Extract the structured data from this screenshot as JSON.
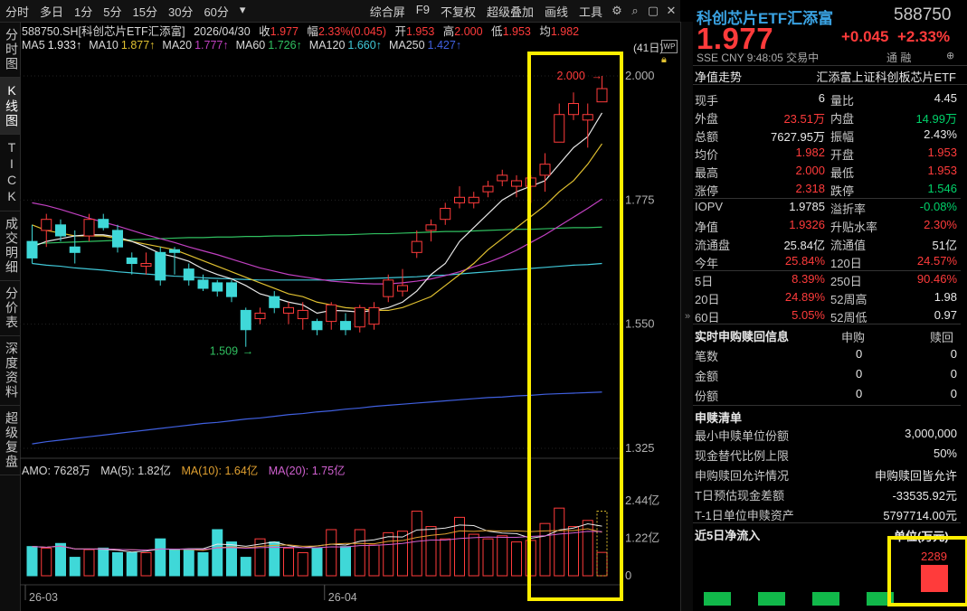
{
  "toolbar": {
    "periods": [
      "分时",
      "多日",
      "1分",
      "5分",
      "15分",
      "30分",
      "60分",
      "▾"
    ],
    "tools": [
      "综合屏",
      "F9",
      "不复权",
      "超级叠加",
      "画线",
      "工具"
    ]
  },
  "left_tabs": [
    "分时图",
    "K线图",
    "TICK",
    "成交明细",
    "分价表",
    "深度资料",
    "超级复盘"
  ],
  "header": {
    "code_line": "588750.SH[科创芯片ETF汇添富]",
    "date": "2026/04/30",
    "close_label": "收",
    "close": "1.977",
    "amp_label": "幅",
    "amp": "2.33%(0.045)",
    "open_label": "开",
    "open": "1.953",
    "high_label": "高",
    "high": "2.000",
    "low_label": "低",
    "low": "1.953",
    "avg_label": "均",
    "avg": "1.982"
  },
  "ma_legend": [
    {
      "name": "MA5",
      "value": "1.933↑",
      "color": "#e8e8e8"
    },
    {
      "name": "MA10",
      "value": "1.877↑",
      "color": "#e0c030"
    },
    {
      "name": "MA20",
      "value": "1.777↑",
      "color": "#c040c0"
    },
    {
      "name": "MA60",
      "value": "1.726↑",
      "color": "#30c060"
    },
    {
      "name": "MA120",
      "value": "1.660↑",
      "color": "#40c8d8"
    },
    {
      "name": "MA250",
      "value": "1.427↑",
      "color": "#4060e0"
    }
  ],
  "count_tag": "(41日)",
  "volume_legend": {
    "amo": "AMO: 7628万",
    "ma5": "MA(5): 1.82亿",
    "ma10": "MA(10): 1.64亿",
    "ma20": "MA(20): 1.75亿"
  },
  "price_axis": [
    "2.000",
    "1.775",
    "1.550",
    "1.325"
  ],
  "volume_axis": [
    "2.44亿",
    "1.22亿",
    "0"
  ],
  "date_axis": [
    "26-03",
    "26-04"
  ],
  "annotations": {
    "high": "2.000",
    "low": "1.509"
  },
  "chart_data": {
    "type": "candlestick",
    "ylim": [
      1.325,
      2.0
    ],
    "candles": [
      {
        "o": 1.7,
        "h": 1.73,
        "l": 1.66,
        "c": 1.67
      },
      {
        "o": 1.72,
        "h": 1.75,
        "l": 1.69,
        "c": 1.74
      },
      {
        "o": 1.73,
        "h": 1.74,
        "l": 1.7,
        "c": 1.71
      },
      {
        "o": 1.69,
        "h": 1.72,
        "l": 1.66,
        "c": 1.68
      },
      {
        "o": 1.71,
        "h": 1.75,
        "l": 1.7,
        "c": 1.74
      },
      {
        "o": 1.74,
        "h": 1.75,
        "l": 1.72,
        "c": 1.725
      },
      {
        "o": 1.72,
        "h": 1.73,
        "l": 1.68,
        "c": 1.69
      },
      {
        "o": 1.67,
        "h": 1.68,
        "l": 1.64,
        "c": 1.66
      },
      {
        "o": 1.655,
        "h": 1.68,
        "l": 1.64,
        "c": 1.66
      },
      {
        "o": 1.68,
        "h": 1.69,
        "l": 1.62,
        "c": 1.63
      },
      {
        "o": 1.685,
        "h": 1.69,
        "l": 1.64,
        "c": 1.68
      },
      {
        "o": 1.65,
        "h": 1.66,
        "l": 1.62,
        "c": 1.63
      },
      {
        "o": 1.63,
        "h": 1.64,
        "l": 1.61,
        "c": 1.615
      },
      {
        "o": 1.625,
        "h": 1.63,
        "l": 1.6,
        "c": 1.61
      },
      {
        "o": 1.625,
        "h": 1.63,
        "l": 1.59,
        "c": 1.6
      },
      {
        "o": 1.575,
        "h": 1.58,
        "l": 1.509,
        "c": 1.54
      },
      {
        "o": 1.56,
        "h": 1.58,
        "l": 1.55,
        "c": 1.57
      },
      {
        "o": 1.6,
        "h": 1.61,
        "l": 1.57,
        "c": 1.58
      },
      {
        "o": 1.57,
        "h": 1.59,
        "l": 1.55,
        "c": 1.58
      },
      {
        "o": 1.56,
        "h": 1.59,
        "l": 1.54,
        "c": 1.575
      },
      {
        "o": 1.555,
        "h": 1.56,
        "l": 1.53,
        "c": 1.54
      },
      {
        "o": 1.555,
        "h": 1.59,
        "l": 1.54,
        "c": 1.585
      },
      {
        "o": 1.555,
        "h": 1.57,
        "l": 1.53,
        "c": 1.54
      },
      {
        "o": 1.545,
        "h": 1.585,
        "l": 1.535,
        "c": 1.58
      },
      {
        "o": 1.55,
        "h": 1.59,
        "l": 1.54,
        "c": 1.58
      },
      {
        "o": 1.6,
        "h": 1.64,
        "l": 1.59,
        "c": 1.63
      },
      {
        "o": 1.61,
        "h": 1.65,
        "l": 1.6,
        "c": 1.62
      },
      {
        "o": 1.68,
        "h": 1.72,
        "l": 1.67,
        "c": 1.7
      },
      {
        "o": 1.72,
        "h": 1.74,
        "l": 1.7,
        "c": 1.73
      },
      {
        "o": 1.74,
        "h": 1.77,
        "l": 1.73,
        "c": 1.76
      },
      {
        "o": 1.77,
        "h": 1.8,
        "l": 1.76,
        "c": 1.78
      },
      {
        "o": 1.77,
        "h": 1.79,
        "l": 1.76,
        "c": 1.78
      },
      {
        "o": 1.79,
        "h": 1.81,
        "l": 1.78,
        "c": 1.8
      },
      {
        "o": 1.81,
        "h": 1.83,
        "l": 1.8,
        "c": 1.82
      },
      {
        "o": 1.8,
        "h": 1.82,
        "l": 1.78,
        "c": 1.81
      },
      {
        "o": 1.8,
        "h": 1.82,
        "l": 1.77,
        "c": 1.815
      },
      {
        "o": 1.82,
        "h": 1.86,
        "l": 1.79,
        "c": 1.84
      },
      {
        "o": 1.88,
        "h": 1.95,
        "l": 1.88,
        "c": 1.93
      },
      {
        "o": 1.93,
        "h": 1.97,
        "l": 1.92,
        "c": 1.95
      },
      {
        "o": 1.92,
        "h": 1.95,
        "l": 1.87,
        "c": 1.93
      },
      {
        "o": 1.953,
        "h": 2.0,
        "l": 1.953,
        "c": 1.977
      }
    ],
    "volumes": [
      0.95,
      0.9,
      1.05,
      0.6,
      0.85,
      0.9,
      0.75,
      0.75,
      0.75,
      1.2,
      0.85,
      0.85,
      0.75,
      1.5,
      1.1,
      0.6,
      1.2,
      1.1,
      0.9,
      0.75,
      0.9,
      1.5,
      0.95,
      1.5,
      1.0,
      1.4,
      1.45,
      2.1,
      1.6,
      1.2,
      1.9,
      1.35,
      1.2,
      1.3,
      1.1,
      1.15,
      1.7,
      2.2,
      1.6,
      1.8,
      0.76
    ],
    "ma5": [
      1.69,
      1.7,
      1.705,
      1.71,
      1.712,
      1.712,
      1.708,
      1.7,
      1.69,
      1.678,
      1.672,
      1.664,
      1.65,
      1.64,
      1.632,
      1.62,
      1.605,
      1.598,
      1.59,
      1.585,
      1.57,
      1.575,
      1.574,
      1.572,
      1.575,
      1.58,
      1.59,
      1.61,
      1.64,
      1.66,
      1.7,
      1.725,
      1.75,
      1.775,
      1.79,
      1.8,
      1.81,
      1.84,
      1.87,
      1.89,
      1.933
    ],
    "ma10": [
      1.73,
      1.72,
      1.715,
      1.71,
      1.71,
      1.71,
      1.705,
      1.7,
      1.695,
      1.69,
      1.685,
      1.675,
      1.665,
      1.655,
      1.645,
      1.635,
      1.625,
      1.615,
      1.605,
      1.6,
      1.59,
      1.585,
      1.58,
      1.578,
      1.575,
      1.575,
      1.58,
      1.59,
      1.6,
      1.62,
      1.64,
      1.66,
      1.685,
      1.705,
      1.725,
      1.745,
      1.765,
      1.79,
      1.81,
      1.84,
      1.877
    ],
    "ma20": [
      1.77,
      1.765,
      1.758,
      1.75,
      1.742,
      1.735,
      1.728,
      1.72,
      1.712,
      1.705,
      1.698,
      1.69,
      1.683,
      1.676,
      1.668,
      1.66,
      1.652,
      1.646,
      1.64,
      1.636,
      1.632,
      1.628,
      1.626,
      1.624,
      1.623,
      1.623,
      1.625,
      1.628,
      1.632,
      1.638,
      1.645,
      1.654,
      1.662,
      1.672,
      1.684,
      1.698,
      1.712,
      1.728,
      1.744,
      1.76,
      1.777
    ],
    "ma60": [
      1.695,
      1.697,
      1.698,
      1.699,
      1.7,
      1.701,
      1.702,
      1.703,
      1.704,
      1.705,
      1.706,
      1.707,
      1.707,
      1.708,
      1.708,
      1.709,
      1.709,
      1.71,
      1.71,
      1.711,
      1.711,
      1.712,
      1.712,
      1.713,
      1.714,
      1.714,
      1.715,
      1.716,
      1.717,
      1.718,
      1.718,
      1.719,
      1.72,
      1.721,
      1.722,
      1.722,
      1.723,
      1.724,
      1.725,
      1.725,
      1.726
    ],
    "ma120": [
      1.66,
      1.657,
      1.655,
      1.652,
      1.65,
      1.648,
      1.645,
      1.643,
      1.641,
      1.639,
      1.637,
      1.636,
      1.634,
      1.633,
      1.632,
      1.631,
      1.63,
      1.63,
      1.63,
      1.63,
      1.63,
      1.63,
      1.631,
      1.632,
      1.633,
      1.634,
      1.635,
      1.636,
      1.638,
      1.639,
      1.641,
      1.643,
      1.645,
      1.647,
      1.649,
      1.651,
      1.653,
      1.655,
      1.657,
      1.658,
      1.66
    ],
    "ma250": [
      1.333,
      1.337,
      1.34,
      1.343,
      1.346,
      1.349,
      1.352,
      1.355,
      1.358,
      1.361,
      1.364,
      1.367,
      1.37,
      1.372,
      1.375,
      1.378,
      1.38,
      1.383,
      1.386,
      1.388,
      1.391,
      1.393,
      1.396,
      1.398,
      1.401,
      1.403,
      1.405,
      1.407,
      1.409,
      1.411,
      1.413,
      1.415,
      1.417,
      1.418,
      1.42,
      1.421,
      1.423,
      1.424,
      1.425,
      1.426,
      1.427
    ]
  },
  "right_panel": {
    "name": "科创芯片ETF汇添富",
    "code": "588750",
    "price": "1.977",
    "change": "+0.045",
    "change_pct": "+2.33%",
    "meta": "SSE  CNY  9:48:05  交易中",
    "tong": "通  融",
    "nav_trend": "净值走势",
    "index_name": "汇添富上证科创板芯片ETF",
    "rows": [
      {
        "l1": "现手",
        "v1": "6",
        "c1": "white",
        "l2": "量比",
        "v2": "4.45",
        "c2": "white"
      },
      {
        "l1": "外盘",
        "v1": "23.51万",
        "c1": "red",
        "l2": "内盘",
        "v2": "14.99万",
        "c2": "green"
      },
      {
        "l1": "总额",
        "v1": "7627.95万",
        "c1": "white",
        "l2": "振幅",
        "v2": "2.43%",
        "c2": "white"
      },
      {
        "l1": "均价",
        "v1": "1.982",
        "c1": "red",
        "l2": "开盘",
        "v2": "1.953",
        "c2": "red"
      },
      {
        "l1": "最高",
        "v1": "2.000",
        "c1": "red",
        "l2": "最低",
        "v2": "1.953",
        "c2": "red"
      },
      {
        "l1": "涨停",
        "v1": "2.318",
        "c1": "red",
        "l2": "跌停",
        "v2": "1.546",
        "c2": "green"
      },
      {
        "l1": "IOPV",
        "v1": "1.9785",
        "c1": "white",
        "l2": "溢折率",
        "v2": "-0.08%",
        "c2": "green"
      },
      {
        "l1": "净值",
        "v1": "1.9326",
        "c1": "red",
        "l2": "升贴水率",
        "v2": "2.30%",
        "c2": "red"
      },
      {
        "l1": "流通盘",
        "v1": "25.84亿",
        "c1": "white",
        "l2": "流通值",
        "v2": "51亿",
        "c2": "white"
      },
      {
        "l1": "今年",
        "v1": "25.84%",
        "c1": "red",
        "l2": "120日",
        "v2": "24.57%",
        "c2": "red"
      },
      {
        "l1": "5日",
        "v1": "8.39%",
        "c1": "red",
        "l2": "250日",
        "v2": "90.46%",
        "c2": "red"
      },
      {
        "l1": "20日",
        "v1": "24.89%",
        "c1": "red",
        "l2": "52周高",
        "v2": "1.98",
        "c2": "white"
      },
      {
        "l1": "60日",
        "v1": "5.05%",
        "c1": "red",
        "l2": "52周低",
        "v2": "0.97",
        "c2": "white"
      }
    ],
    "realtime": {
      "title": "实时申购赎回信息",
      "col1": "申购",
      "col2": "赎回",
      "rows": [
        {
          "label": "笔数",
          "a": "0",
          "b": "0"
        },
        {
          "label": "金额",
          "a": "0",
          "b": "0"
        },
        {
          "label": "份额",
          "a": "0",
          "b": "0"
        }
      ]
    },
    "list": {
      "title": "申赎清单",
      "rows": [
        {
          "k": "最小申赎单位份额",
          "v": "3,000,000"
        },
        {
          "k": "现金替代比例上限",
          "v": "50%"
        },
        {
          "k": "申购赎回允许情况",
          "v": "申购赎回皆允许"
        },
        {
          "k": "T日预估现金差额",
          "v": "-33535.92元"
        },
        {
          "k": "T-1日单位申赎资产",
          "v": "5797714.00元"
        }
      ]
    },
    "flow": {
      "title": "近5日净流入",
      "unit": "单位(万元)",
      "value": "2289"
    }
  }
}
